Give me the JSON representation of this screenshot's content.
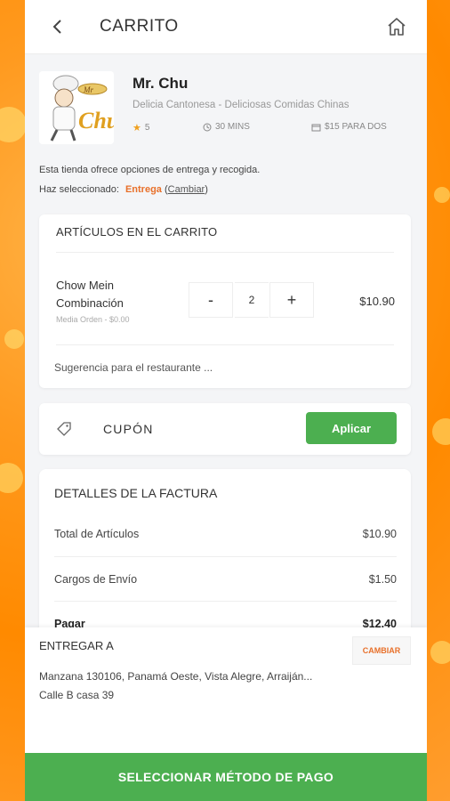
{
  "header": {
    "title": "CARRITO",
    "back_icon": "chevron-left-icon",
    "home_icon": "home-icon"
  },
  "restaurant": {
    "name": "Mr. Chu",
    "description": "Delicia Cantonesa - Deliciosas Comidas Chinas",
    "rating": "5",
    "time": "30 MINS",
    "price_for_two": "$15 PARA DOS",
    "logo_text": "Mr. Chu",
    "notice": "Esta tienda ofrece opciones de entrega y recogida.",
    "selected_prefix": "Haz seleccionado:",
    "selected_mode": "Entrega",
    "change_open": "(",
    "change_link": "Cambiar",
    "change_close": ")"
  },
  "cart": {
    "title": "ARTÍCULOS EN EL CARRITO",
    "items": [
      {
        "name": "Chow Mein Combinación",
        "option": "Media Orden - $0.00",
        "qty": "2",
        "price": "$10.90",
        "minus": "-",
        "plus": "+"
      }
    ],
    "suggestion_placeholder": "Sugerencia para el restaurante ..."
  },
  "coupon": {
    "label": "CUPÓN",
    "apply_label": "Aplicar"
  },
  "bill": {
    "title": "DETALLES DE LA FACTURA",
    "rows": [
      {
        "label": "Total de Artículos",
        "value": "$10.90"
      },
      {
        "label": "Cargos de Envío",
        "value": "$1.50"
      },
      {
        "label": "Pagar",
        "value": "$12.40"
      }
    ]
  },
  "delivery": {
    "title": "ENTREGAR A",
    "change_label": "CAMBIAR",
    "address_line1": "Manzana 130106, Panamá Oeste, Vista Alegre, Arraiján...",
    "address_line2": "Calle B casa 39"
  },
  "footer": {
    "pay_label": "SELECCIONAR MÉTODO DE PAGO"
  },
  "colors": {
    "accent_green": "#4caf50",
    "accent_orange": "#e8702a",
    "star": "#f0a020"
  }
}
